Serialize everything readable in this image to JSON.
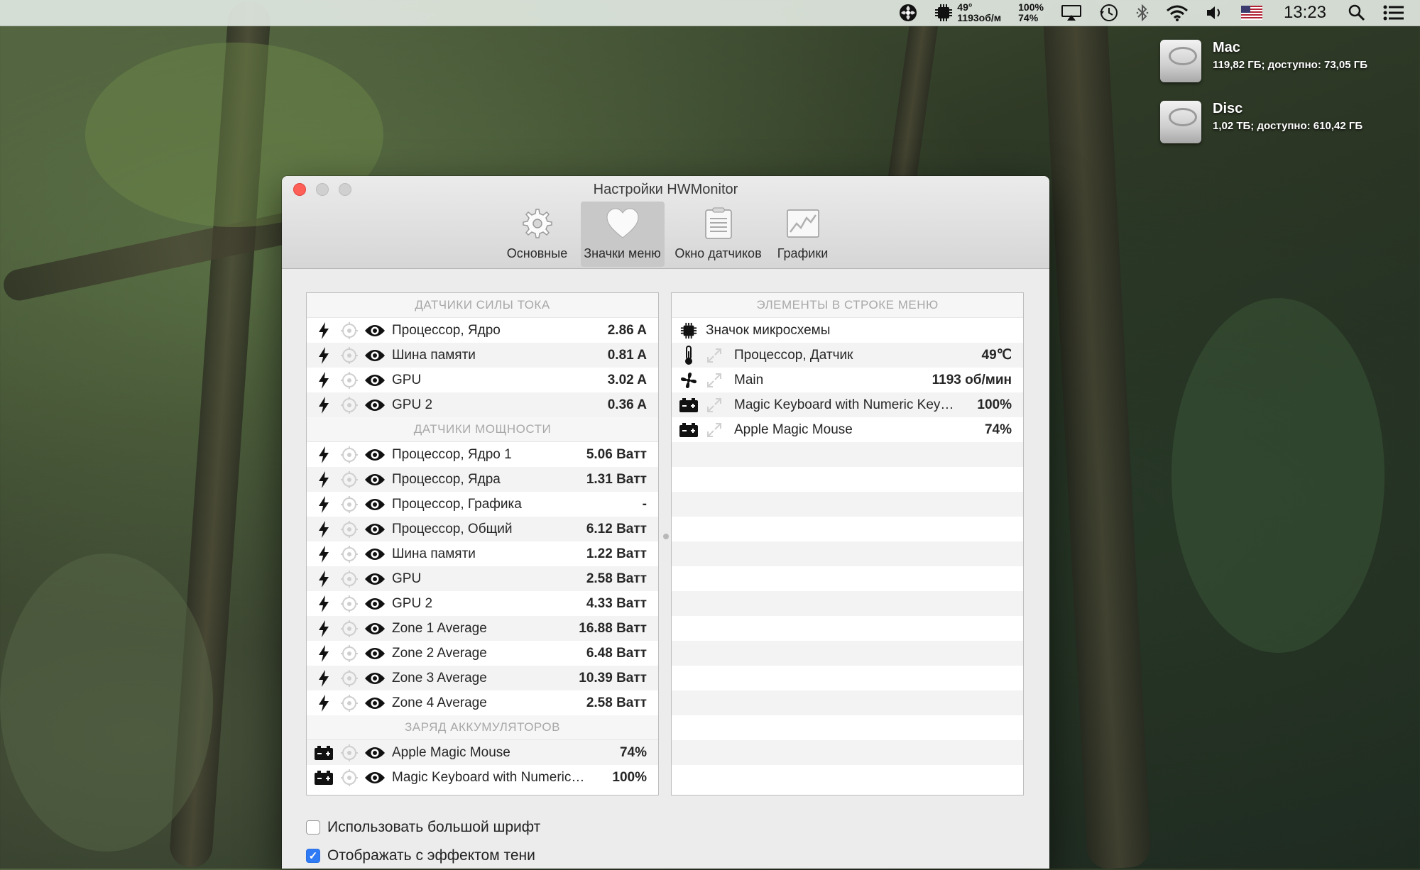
{
  "menubar": {
    "items": [
      {
        "icon": "fan-icon"
      },
      {
        "icon": "chip-icon",
        "top": "49°",
        "bottom": "1193об/м"
      },
      {
        "top": "100%",
        "bottom": "74%"
      },
      {
        "icon": "airplay-icon"
      },
      {
        "icon": "time-machine-icon"
      },
      {
        "icon": "bluetooth-icon"
      },
      {
        "icon": "wifi-icon"
      },
      {
        "icon": "volume-icon"
      },
      {
        "icon": "us-flag-icon"
      }
    ],
    "time": "13:23"
  },
  "desktop": {
    "drives": [
      {
        "name": "Mac",
        "info": "119,82 ГБ; доступно: 73,05 ГБ"
      },
      {
        "name": "Disc",
        "info": "1,02 ТБ; доступно: 610,42 ГБ"
      }
    ]
  },
  "window": {
    "title": "Настройки HWMonitor",
    "tabs": [
      {
        "label": "Основные",
        "icon": "gear-icon"
      },
      {
        "label": "Значки меню",
        "icon": "heart-icon",
        "active": true
      },
      {
        "label": "Окно датчиков",
        "icon": "list-icon"
      },
      {
        "label": "Графики",
        "icon": "graph-icon"
      }
    ]
  },
  "left": {
    "sections": [
      {
        "header": "ДАТЧИКИ СИЛЫ ТОКА",
        "rows": [
          {
            "label": "Процессор, Ядро",
            "value": "2.86 A"
          },
          {
            "label": "Шина памяти",
            "value": "0.81 A"
          },
          {
            "label": "GPU",
            "value": "3.02 A"
          },
          {
            "label": "GPU 2",
            "value": "0.36 A"
          }
        ]
      },
      {
        "header": "ДАТЧИКИ МОЩНОСТИ",
        "rows": [
          {
            "label": "Процессор, Ядро 1",
            "value": "5.06 Ватт"
          },
          {
            "label": "Процессор, Ядра",
            "value": "1.31 Ватт"
          },
          {
            "label": "Процессор, Графика",
            "value": "-"
          },
          {
            "label": "Процессор, Общий",
            "value": "6.12 Ватт"
          },
          {
            "label": "Шина памяти",
            "value": "1.22 Ватт"
          },
          {
            "label": "GPU",
            "value": "2.58 Ватт"
          },
          {
            "label": "GPU 2",
            "value": "4.33 Ватт"
          },
          {
            "label": "Zone 1 Average",
            "value": "16.88 Ватт"
          },
          {
            "label": "Zone 2 Average",
            "value": "6.48 Ватт"
          },
          {
            "label": "Zone 3 Average",
            "value": "10.39 Ватт"
          },
          {
            "label": "Zone 4 Average",
            "value": "2.58 Ватт"
          }
        ]
      },
      {
        "header": "ЗАРЯД АККУМУЛЯТОРОВ",
        "rows": [
          {
            "label": "Apple Magic Mouse",
            "value": "74%"
          },
          {
            "label": "Magic Keyboard with Numeric…",
            "value": "100%"
          }
        ]
      }
    ]
  },
  "right": {
    "header": "ЭЛЕМЕНТЫ В СТРОКЕ МЕНЮ",
    "chip_label": "Значок микросхемы",
    "rows": [
      {
        "icon": "thermometer-icon",
        "label": "Процессор, Датчик",
        "value": "49℃"
      },
      {
        "icon": "fan-icon",
        "label": "Main",
        "value": "1193 об/мин"
      },
      {
        "icon": "battery-icon",
        "label": "Magic Keyboard with Numeric Key…",
        "value": "100%"
      },
      {
        "icon": "battery-icon",
        "label": "Apple Magic Mouse",
        "value": "74%"
      }
    ]
  },
  "options": {
    "large_font": {
      "label": "Использовать большой шрифт",
      "checked": false
    },
    "shadow": {
      "label": "Отображать с эффектом тени",
      "checked": true
    }
  },
  "colors": {
    "accent": "#2f7bf6",
    "close": "#fe5f57"
  }
}
